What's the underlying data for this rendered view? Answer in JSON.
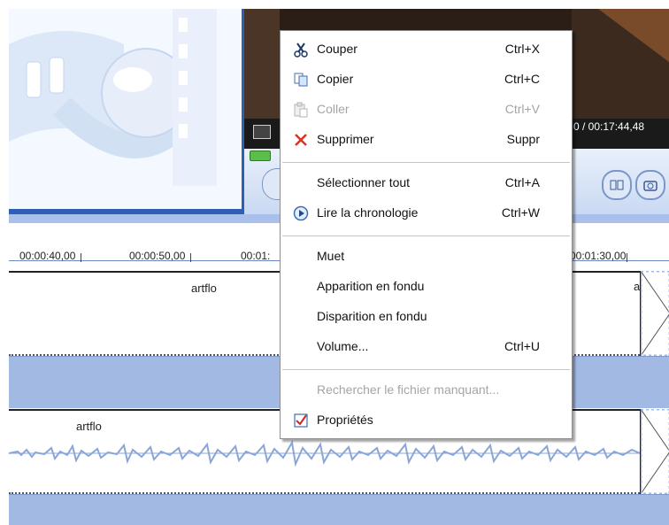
{
  "video": {
    "time_display": "0 / 00:17:44,48"
  },
  "timeline": {
    "ruler_labels": [
      "00:00:40,00",
      "00:00:50,00",
      "00:01:",
      "00:01:30,00"
    ],
    "video_track": {
      "clip_label": "artflo",
      "clip_label_right": "a"
    },
    "audio_track": {
      "clip_label": "artflo"
    }
  },
  "context_menu": {
    "items": [
      {
        "label": "Couper",
        "shortcut": "Ctrl+X",
        "icon": "scissors-icon",
        "enabled": true
      },
      {
        "label": "Copier",
        "shortcut": "Ctrl+C",
        "icon": "copy-icon",
        "enabled": true
      },
      {
        "label": "Coller",
        "shortcut": "Ctrl+V",
        "icon": "paste-icon",
        "enabled": false
      },
      {
        "label": "Supprimer",
        "shortcut": "Suppr",
        "icon": "delete-x-icon",
        "enabled": true
      },
      {
        "label": "Sélectionner tout",
        "shortcut": "Ctrl+A",
        "enabled": true
      },
      {
        "label": "Lire la chronologie",
        "shortcut": "Ctrl+W",
        "icon": "play-circle-icon",
        "enabled": true
      },
      {
        "label": "Muet",
        "shortcut": "",
        "enabled": true
      },
      {
        "label": "Apparition en fondu",
        "shortcut": "",
        "enabled": true
      },
      {
        "label": "Disparition en fondu",
        "shortcut": "",
        "enabled": true
      },
      {
        "label": "Volume...",
        "shortcut": "Ctrl+U",
        "enabled": true
      },
      {
        "label": "Rechercher le fichier manquant...",
        "shortcut": "",
        "enabled": false
      },
      {
        "label": "Propriétés",
        "shortcut": "",
        "icon": "properties-check-icon",
        "enabled": true
      }
    ]
  },
  "colors": {
    "track_blue": "#a2b9e4",
    "waveform": "#8aa6d8",
    "pane_border": "#2f5fb5"
  }
}
